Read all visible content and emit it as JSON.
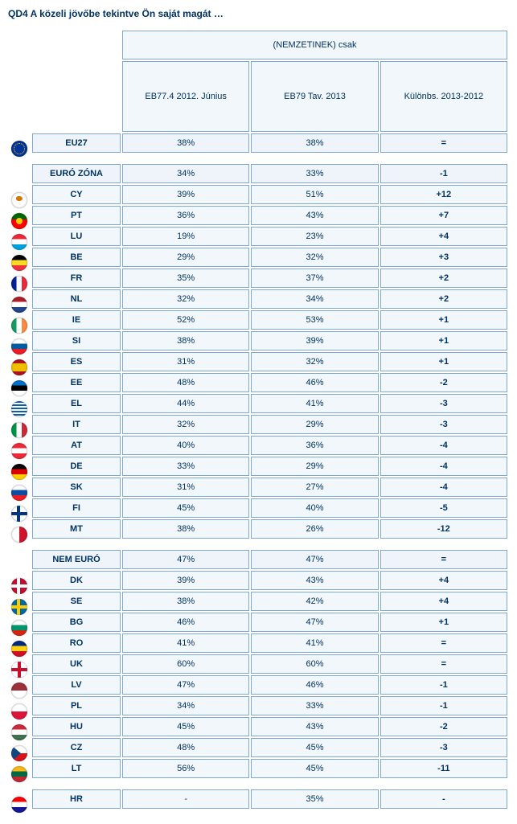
{
  "title": "QD4 A közeli jövőbe tekintve Ön saját magát …",
  "header": {
    "group": "(NEMZETINEK) csak",
    "col1": "EB77.4 2012. Június",
    "col2": "EB79 Tav. 2013",
    "col3": "Különbs. 2013-2012"
  },
  "rows": [
    {
      "type": "data",
      "flag": {
        "bg": "#003399",
        "dots": true
      },
      "label": "EU27",
      "v1": "38%",
      "v2": "38%",
      "diff": "=",
      "agg": true
    },
    {
      "type": "spacer"
    },
    {
      "type": "data",
      "flag": null,
      "label": "EURÓ ZÓNA",
      "v1": "34%",
      "v2": "33%",
      "diff": "-1",
      "agg": true
    },
    {
      "type": "data",
      "flag": {
        "bg": "#fff",
        "overlay": "cyprus"
      },
      "label": "CY",
      "v1": "39%",
      "v2": "51%",
      "diff": "+12"
    },
    {
      "type": "data",
      "flag": {
        "bg": "linear-gradient(#006600 40%,#ff0000 40%)",
        "dot": "#ffcc00"
      },
      "label": "PT",
      "v1": "36%",
      "v2": "43%",
      "diff": "+7"
    },
    {
      "type": "data",
      "flag": {
        "bg": "linear-gradient(#ed2939 33%,#fff 33% 66%,#00a1de 66%)"
      },
      "label": "LU",
      "v1": "19%",
      "v2": "23%",
      "diff": "+4"
    },
    {
      "type": "data",
      "flag": {
        "bg": "linear-gradient(#000 33%,#fdda24 33% 66%,#ef3340 66%)"
      },
      "label": "BE",
      "v1": "29%",
      "v2": "32%",
      "diff": "+3"
    },
    {
      "type": "data",
      "flag": {
        "bg": "linear-gradient(90deg,#002395 33%,#fff 33% 66%,#ed2939 66%)"
      },
      "label": "FR",
      "v1": "35%",
      "v2": "37%",
      "diff": "+2"
    },
    {
      "type": "data",
      "flag": {
        "bg": "linear-gradient(#ae1c28 33%,#fff 33% 66%,#21468b 66%)"
      },
      "label": "NL",
      "v1": "32%",
      "v2": "34%",
      "diff": "+2"
    },
    {
      "type": "data",
      "flag": {
        "bg": "linear-gradient(90deg,#169b62 33%,#fff 33% 66%,#ff883e 66%)"
      },
      "label": "IE",
      "v1": "52%",
      "v2": "53%",
      "diff": "+1"
    },
    {
      "type": "data",
      "flag": {
        "bg": "linear-gradient(#fff 33%,#005da4 33% 66%,#ed1c24 66%)"
      },
      "label": "SI",
      "v1": "38%",
      "v2": "39%",
      "diff": "+1"
    },
    {
      "type": "data",
      "flag": {
        "bg": "linear-gradient(#aa151b 25%,#f1bf00 25% 75%,#aa151b 75%)"
      },
      "label": "ES",
      "v1": "31%",
      "v2": "32%",
      "diff": "+1"
    },
    {
      "type": "data",
      "flag": {
        "bg": "linear-gradient(#0072ce 33%,#000 33% 66%,#fff 66%)"
      },
      "label": "EE",
      "v1": "48%",
      "v2": "46%",
      "diff": "-2"
    },
    {
      "type": "data",
      "flag": {
        "bg": "repeating-linear-gradient(#0d5eaf 0 2px,#fff 2px 4px)"
      },
      "label": "EL",
      "v1": "44%",
      "v2": "41%",
      "diff": "-3"
    },
    {
      "type": "data",
      "flag": {
        "bg": "linear-gradient(90deg,#009246 33%,#fff 33% 66%,#ce2b37 66%)"
      },
      "label": "IT",
      "v1": "32%",
      "v2": "29%",
      "diff": "-3"
    },
    {
      "type": "data",
      "flag": {
        "bg": "linear-gradient(#ed2939 33%,#fff 33% 66%,#ed2939 66%)"
      },
      "label": "AT",
      "v1": "40%",
      "v2": "36%",
      "diff": "-4"
    },
    {
      "type": "data",
      "flag": {
        "bg": "linear-gradient(#000 33%,#dd0000 33% 66%,#ffce00 66%)"
      },
      "label": "DE",
      "v1": "33%",
      "v2": "29%",
      "diff": "-4"
    },
    {
      "type": "data",
      "flag": {
        "bg": "linear-gradient(#fff 33%,#0b4ea2 33% 66%,#ee1c25 66%)"
      },
      "label": "SK",
      "v1": "31%",
      "v2": "27%",
      "diff": "-4"
    },
    {
      "type": "data",
      "flag": {
        "bg": "#fff",
        "cross": "#003580"
      },
      "label": "FI",
      "v1": "45%",
      "v2": "40%",
      "diff": "-5"
    },
    {
      "type": "data",
      "flag": {
        "bg": "#fff",
        "overlay": "malta"
      },
      "label": "MT",
      "v1": "38%",
      "v2": "26%",
      "diff": "-12"
    },
    {
      "type": "spacer"
    },
    {
      "type": "data",
      "flag": null,
      "label": "NEM EURÓ",
      "v1": "47%",
      "v2": "47%",
      "diff": "=",
      "agg": true
    },
    {
      "type": "data",
      "flag": {
        "bg": "#c60c30",
        "cross": "#fff"
      },
      "label": "DK",
      "v1": "39%",
      "v2": "43%",
      "diff": "+4"
    },
    {
      "type": "data",
      "flag": {
        "bg": "#006aa7",
        "cross": "#fecc00"
      },
      "label": "SE",
      "v1": "38%",
      "v2": "42%",
      "diff": "+4"
    },
    {
      "type": "data",
      "flag": {
        "bg": "linear-gradient(#fff 33%,#00966e 33% 66%,#d62612 66%)"
      },
      "label": "BG",
      "v1": "46%",
      "v2": "47%",
      "diff": "+1"
    },
    {
      "type": "data",
      "flag": {
        "bg": "linear-gradient(#002b7f 33%,#fcd116 33% 66%,#ce1126 66%)"
      },
      "label": "RO",
      "v1": "41%",
      "v2": "41%",
      "diff": "="
    },
    {
      "type": "data",
      "flag": {
        "bg": "#012169",
        "overlay": "uk"
      },
      "label": "UK",
      "v1": "60%",
      "v2": "60%",
      "diff": "="
    },
    {
      "type": "data",
      "flag": {
        "bg": "linear-gradient(#9e3039 50%,#fff 50%)"
      },
      "label": "LV",
      "v1": "47%",
      "v2": "46%",
      "diff": "-1"
    },
    {
      "type": "data",
      "flag": {
        "bg": "#fff 50%,#dc143c 50%",
        "bg2": "linear-gradient(#fff 50%,#dc143c 50%)"
      },
      "label": "PL",
      "v1": "34%",
      "v2": "33%",
      "diff": "-1"
    },
    {
      "type": "data",
      "flag": {
        "bg": "linear-gradient(#cd2a3e 33%,#fff 33% 66%,#436f4d 66%)"
      },
      "label": "HU",
      "v1": "45%",
      "v2": "43%",
      "diff": "-2"
    },
    {
      "type": "data",
      "flag": {
        "bg": "linear-gradient(#fff 50%,#d7141a 50%)",
        "overlay": "cz"
      },
      "label": "CZ",
      "v1": "48%",
      "v2": "45%",
      "diff": "-3"
    },
    {
      "type": "data",
      "flag": {
        "bg": "linear-gradient(#fdb913 33%,#006a44 33% 66%,#c1272d 66%)"
      },
      "label": "LT",
      "v1": "56%",
      "v2": "45%",
      "diff": "-11"
    },
    {
      "type": "spacer"
    },
    {
      "type": "data",
      "flag": {
        "bg": "linear-gradient(#ff0000 33%,#fff 33% 66%,#171796 66%)"
      },
      "label": "HR",
      "v1": "-",
      "v2": "35%",
      "diff": "-"
    }
  ]
}
